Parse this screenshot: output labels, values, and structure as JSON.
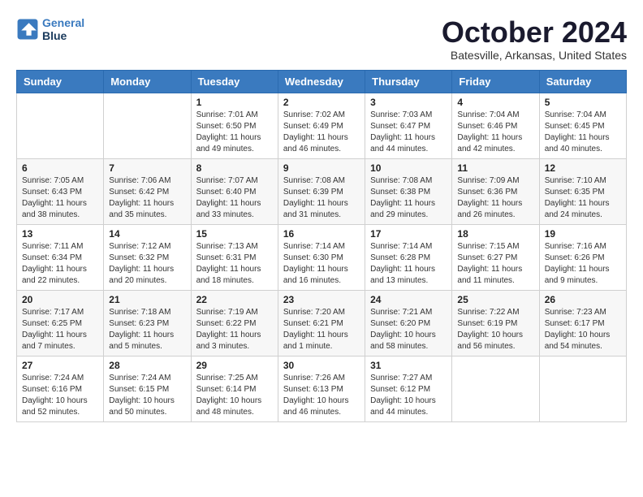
{
  "header": {
    "logo": {
      "line1": "General",
      "line2": "Blue"
    },
    "title": "October 2024",
    "subtitle": "Batesville, Arkansas, United States"
  },
  "weekdays": [
    "Sunday",
    "Monday",
    "Tuesday",
    "Wednesday",
    "Thursday",
    "Friday",
    "Saturday"
  ],
  "weeks": [
    [
      {
        "day": "",
        "info": ""
      },
      {
        "day": "",
        "info": ""
      },
      {
        "day": "1",
        "info": "Sunrise: 7:01 AM\nSunset: 6:50 PM\nDaylight: 11 hours and 49 minutes."
      },
      {
        "day": "2",
        "info": "Sunrise: 7:02 AM\nSunset: 6:49 PM\nDaylight: 11 hours and 46 minutes."
      },
      {
        "day": "3",
        "info": "Sunrise: 7:03 AM\nSunset: 6:47 PM\nDaylight: 11 hours and 44 minutes."
      },
      {
        "day": "4",
        "info": "Sunrise: 7:04 AM\nSunset: 6:46 PM\nDaylight: 11 hours and 42 minutes."
      },
      {
        "day": "5",
        "info": "Sunrise: 7:04 AM\nSunset: 6:45 PM\nDaylight: 11 hours and 40 minutes."
      }
    ],
    [
      {
        "day": "6",
        "info": "Sunrise: 7:05 AM\nSunset: 6:43 PM\nDaylight: 11 hours and 38 minutes."
      },
      {
        "day": "7",
        "info": "Sunrise: 7:06 AM\nSunset: 6:42 PM\nDaylight: 11 hours and 35 minutes."
      },
      {
        "day": "8",
        "info": "Sunrise: 7:07 AM\nSunset: 6:40 PM\nDaylight: 11 hours and 33 minutes."
      },
      {
        "day": "9",
        "info": "Sunrise: 7:08 AM\nSunset: 6:39 PM\nDaylight: 11 hours and 31 minutes."
      },
      {
        "day": "10",
        "info": "Sunrise: 7:08 AM\nSunset: 6:38 PM\nDaylight: 11 hours and 29 minutes."
      },
      {
        "day": "11",
        "info": "Sunrise: 7:09 AM\nSunset: 6:36 PM\nDaylight: 11 hours and 26 minutes."
      },
      {
        "day": "12",
        "info": "Sunrise: 7:10 AM\nSunset: 6:35 PM\nDaylight: 11 hours and 24 minutes."
      }
    ],
    [
      {
        "day": "13",
        "info": "Sunrise: 7:11 AM\nSunset: 6:34 PM\nDaylight: 11 hours and 22 minutes."
      },
      {
        "day": "14",
        "info": "Sunrise: 7:12 AM\nSunset: 6:32 PM\nDaylight: 11 hours and 20 minutes."
      },
      {
        "day": "15",
        "info": "Sunrise: 7:13 AM\nSunset: 6:31 PM\nDaylight: 11 hours and 18 minutes."
      },
      {
        "day": "16",
        "info": "Sunrise: 7:14 AM\nSunset: 6:30 PM\nDaylight: 11 hours and 16 minutes."
      },
      {
        "day": "17",
        "info": "Sunrise: 7:14 AM\nSunset: 6:28 PM\nDaylight: 11 hours and 13 minutes."
      },
      {
        "day": "18",
        "info": "Sunrise: 7:15 AM\nSunset: 6:27 PM\nDaylight: 11 hours and 11 minutes."
      },
      {
        "day": "19",
        "info": "Sunrise: 7:16 AM\nSunset: 6:26 PM\nDaylight: 11 hours and 9 minutes."
      }
    ],
    [
      {
        "day": "20",
        "info": "Sunrise: 7:17 AM\nSunset: 6:25 PM\nDaylight: 11 hours and 7 minutes."
      },
      {
        "day": "21",
        "info": "Sunrise: 7:18 AM\nSunset: 6:23 PM\nDaylight: 11 hours and 5 minutes."
      },
      {
        "day": "22",
        "info": "Sunrise: 7:19 AM\nSunset: 6:22 PM\nDaylight: 11 hours and 3 minutes."
      },
      {
        "day": "23",
        "info": "Sunrise: 7:20 AM\nSunset: 6:21 PM\nDaylight: 11 hours and 1 minute."
      },
      {
        "day": "24",
        "info": "Sunrise: 7:21 AM\nSunset: 6:20 PM\nDaylight: 10 hours and 58 minutes."
      },
      {
        "day": "25",
        "info": "Sunrise: 7:22 AM\nSunset: 6:19 PM\nDaylight: 10 hours and 56 minutes."
      },
      {
        "day": "26",
        "info": "Sunrise: 7:23 AM\nSunset: 6:17 PM\nDaylight: 10 hours and 54 minutes."
      }
    ],
    [
      {
        "day": "27",
        "info": "Sunrise: 7:24 AM\nSunset: 6:16 PM\nDaylight: 10 hours and 52 minutes."
      },
      {
        "day": "28",
        "info": "Sunrise: 7:24 AM\nSunset: 6:15 PM\nDaylight: 10 hours and 50 minutes."
      },
      {
        "day": "29",
        "info": "Sunrise: 7:25 AM\nSunset: 6:14 PM\nDaylight: 10 hours and 48 minutes."
      },
      {
        "day": "30",
        "info": "Sunrise: 7:26 AM\nSunset: 6:13 PM\nDaylight: 10 hours and 46 minutes."
      },
      {
        "day": "31",
        "info": "Sunrise: 7:27 AM\nSunset: 6:12 PM\nDaylight: 10 hours and 44 minutes."
      },
      {
        "day": "",
        "info": ""
      },
      {
        "day": "",
        "info": ""
      }
    ]
  ]
}
